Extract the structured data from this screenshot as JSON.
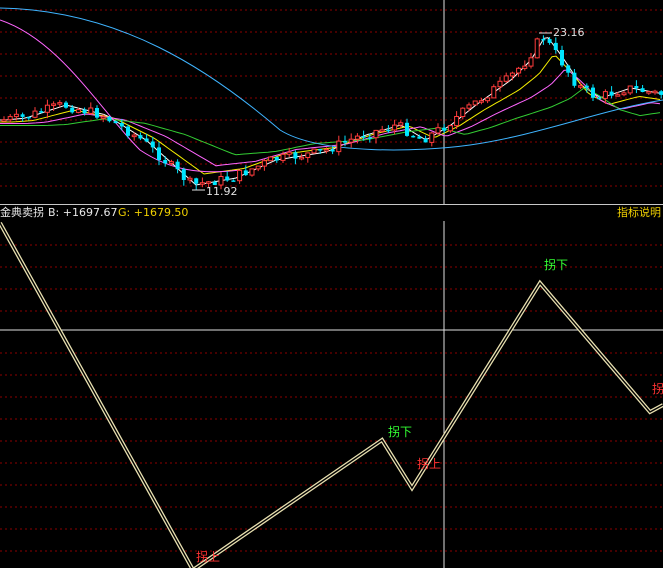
{
  "header": {
    "title": "金典卖拐",
    "b_label": "B: +1697.67",
    "g_label": "G: +1679.50",
    "help_button": "指标说明"
  },
  "price_chart": {
    "high_label": "23.16",
    "low_label": "11.92"
  },
  "indicator_chart": {
    "signals": [
      "拐下",
      "拐上",
      "拐下",
      "拐上",
      "拐上"
    ]
  },
  "colors": {
    "background": "#000000",
    "grid": "#8b0000",
    "up_candle": "#ff3b3b",
    "down_candle": "#00e5ff",
    "ma_white": "#ffffff",
    "ma_yellow": "#f5f000",
    "ma_magenta": "#ff66ff",
    "ma_green": "#33cc33",
    "ma_blue": "#3fb4ff",
    "signal_down": "#33ff33",
    "signal_up": "#ff3333",
    "header_yellow": "#f0d000"
  },
  "chart_data": {
    "type": "line",
    "series": [
      {
        "name": "B",
        "values": [
          1697.67
        ]
      },
      {
        "name": "G",
        "values": [
          1679.5
        ]
      }
    ],
    "ylim": [
      11.92,
      23.16
    ]
  }
}
